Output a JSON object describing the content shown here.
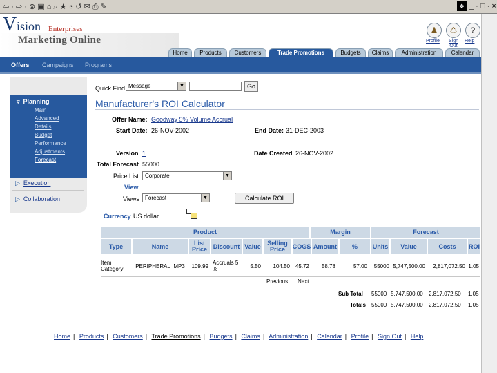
{
  "browser": {
    "nav_glyphs": "⇦ · ⇨ · ⊗ ▣ ⌂  ⌕ ★ ◔ ↺ ✉ ⎙ ✎",
    "window_controls": "_ · □ · ×",
    "brand_glyph": "❖"
  },
  "brand": {
    "v": "V",
    "ision": "ision",
    "enterprises": "Enterprises",
    "app_name": "Marketing Online"
  },
  "utility": {
    "profile": "Profile",
    "signout": "Sign Out",
    "help": "Help"
  },
  "global_tabs": [
    {
      "label": "Home"
    },
    {
      "label": "Products"
    },
    {
      "label": "Customers"
    },
    {
      "label": "Trade Promotions"
    },
    {
      "label": "Budgets"
    },
    {
      "label": "Claims"
    },
    {
      "label": "Administration"
    },
    {
      "label": "Calendar"
    }
  ],
  "sub_tabs": [
    {
      "label": "Offers"
    },
    {
      "label": "Campaigns"
    },
    {
      "label": "Programs"
    }
  ],
  "side_nav": {
    "planning": "Planning",
    "planning_items": [
      "Main",
      "Advanced",
      "Details",
      "Budget",
      "Performance",
      "Adjustments",
      "Forecast"
    ],
    "execution": "Execution",
    "collaboration": "Collaboration"
  },
  "quick_find": {
    "label": "Quick Find",
    "selected": "Message",
    "go": "Go"
  },
  "page": {
    "title": "Manufacturer's ROI Calculator",
    "offer_name_label": "Offer Name:",
    "offer_name": "Goodway 5% Volume Accrual",
    "start_date_label": "Start Date:",
    "start_date": "26-NOV-2002",
    "end_date_label": "End Date:",
    "end_date": "31-DEC-2003",
    "version_label": "Version",
    "version": "1",
    "date_created_label": "Date Created",
    "date_created": "26-NOV-2002",
    "total_forecast_label": "Total Forecast",
    "total_forecast": "55000",
    "price_list_label": "Price List",
    "price_list": "Corporate",
    "view_label": "View",
    "views_label": "Views",
    "views": "Forecast",
    "calculate": "Calculate ROI",
    "currency_label": "Currency",
    "currency": "US dollar"
  },
  "table": {
    "groups": [
      "Product",
      "Margin",
      "Forecast"
    ],
    "columns": [
      "Type",
      "Name",
      "List Price",
      "Discount",
      "Value",
      "Selling Price",
      "COGS",
      "Amount",
      "%",
      "Units",
      "Value",
      "Costs",
      "ROI"
    ],
    "row": [
      "Item Category",
      "PERIPHERAL_MP3",
      "109.99",
      "Accruals 5 %",
      "5.50",
      "104.50",
      "45.72",
      "58.78",
      "57.00",
      "55000",
      "5,747,500.00",
      "2,817,072.50",
      "1.05"
    ],
    "previous": "Previous",
    "next": "Next",
    "subtotal_label": "Sub Total",
    "subtotal": [
      "55000",
      "5,747,500.00",
      "2,817,072.50",
      "1.05"
    ],
    "totals_label": "Totals",
    "totals": [
      "55000",
      "5,747,500.00",
      "2,817,072.50",
      "1.05"
    ]
  },
  "footer": [
    "Home",
    "Products",
    "Customers",
    "Trade Promotions",
    "Budgets",
    "Claims",
    "Administration",
    "Calendar",
    "Profile",
    "Sign Out",
    "Help"
  ]
}
